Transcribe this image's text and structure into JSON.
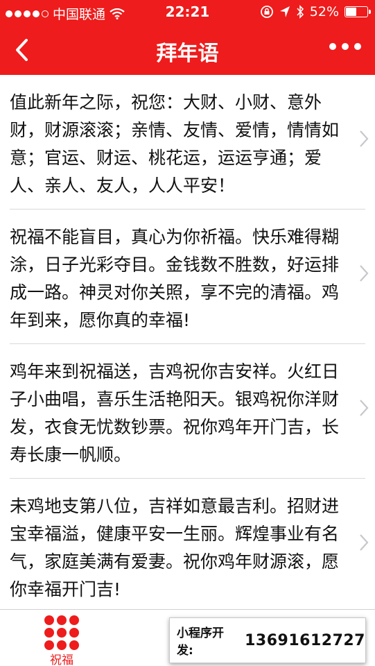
{
  "status_bar": {
    "carrier": "中国联通",
    "time": "22:21",
    "battery": "52%",
    "battery_level": 0.52,
    "signal_icon": "signal-dots-icon",
    "wifi_icon": "wifi-icon",
    "lock_icon": "rotation-lock-icon",
    "location_icon": "location-arrow-icon",
    "bluetooth_icon": "bluetooth-icon"
  },
  "nav": {
    "title": "拜年语",
    "back_icon": "chevron-left-icon",
    "more_icon": "more-dots-icon"
  },
  "items": [
    {
      "text": "值此新年之际，祝您：大财、小财、意外财，财源滚滚；亲情、友情、爱情，情情如意；官运、财运、桃花运，运运亨通；爱人、亲人、友人，人人平安！"
    },
    {
      "text": "祝福不能盲目，真心为你祈福。快乐难得糊涂，日子光彩夺目。金钱数不胜数，好运排成一路。神灵对你关照，享不完的清福。鸡年到来，愿你真的幸福!"
    },
    {
      "text": "鸡年来到祝福送，吉鸡祝你吉安祥。火红日子小曲唱，喜乐生活艳阳天。银鸡祝你洋财发，衣食无忧数钞票。祝你鸡年开门吉，长寿长康一帆顺。"
    },
    {
      "text": "未鸡地支第八位，吉祥如意最吉利。招财进宝幸福溢，健康平安一生丽。辉煌事业有名气，家庭美满有爱妻。祝你鸡年财源滚，愿你幸福开门吉!"
    }
  ],
  "tabbar": {
    "tabs": [
      {
        "label": "祝福",
        "icon": "nine-dots-icon"
      }
    ]
  },
  "promo": {
    "label": "小程序开发:",
    "phone": "13691612727"
  },
  "colors": {
    "accent": "#ee1c1c",
    "divider": "#d9d9d9"
  }
}
